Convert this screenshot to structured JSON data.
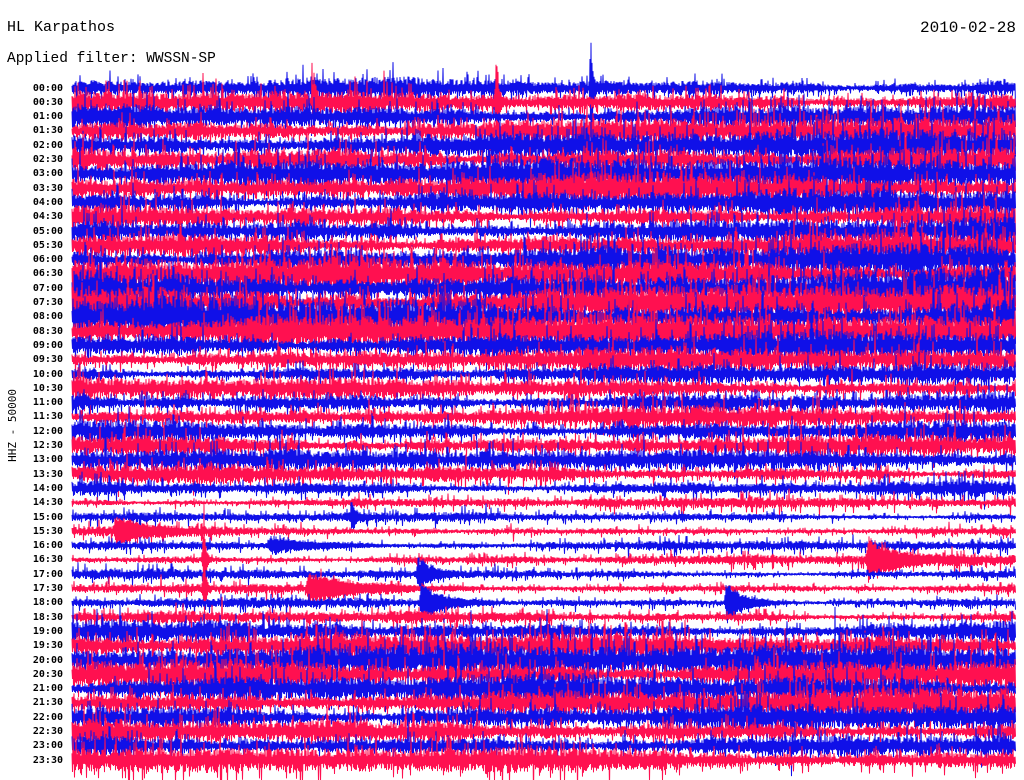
{
  "chart_data": {
    "type": "line",
    "title": "HL Karpathos",
    "date": "2010-02-28",
    "subtitle": "Applied filter: WWSSN-SP",
    "ylabel": "HHZ - 50000",
    "xlim": [
      0,
      30
    ],
    "categories": [
      "00:00",
      "00:30",
      "01:00",
      "01:30",
      "02:00",
      "02:30",
      "03:00",
      "03:30",
      "04:00",
      "04:30",
      "05:00",
      "05:30",
      "06:00",
      "06:30",
      "07:00",
      "07:30",
      "08:00",
      "08:30",
      "09:00",
      "09:30",
      "10:00",
      "10:30",
      "11:00",
      "11:30",
      "12:00",
      "12:30",
      "13:00",
      "13:30",
      "14:00",
      "14:30",
      "15:00",
      "15:30",
      "16:00",
      "16:30",
      "17:00",
      "17:30",
      "18:00",
      "18:30",
      "19:00",
      "19:30",
      "20:00",
      "20:30",
      "21:00",
      "21:30",
      "22:00",
      "22:30",
      "23:00",
      "23:30"
    ],
    "trace_colors": [
      "#1010e8",
      "#ff1050"
    ],
    "amplitude": [
      1.6,
      2.0,
      2.1,
      2.2,
      2.4,
      2.6,
      2.6,
      2.4,
      2.2,
      2.0,
      2.2,
      2.2,
      2.5,
      2.8,
      3.0,
      3.2,
      3.1,
      2.9,
      2.4,
      2.0,
      1.5,
      1.7,
      1.8,
      1.7,
      1.8,
      1.7,
      1.6,
      1.5,
      1.2,
      0.8,
      0.75,
      0.75,
      0.8,
      0.8,
      0.8,
      0.85,
      0.8,
      0.95,
      1.7,
      2.1,
      2.5,
      2.5,
      2.3,
      2.3,
      2.1,
      2.0,
      2.0,
      2.1
    ],
    "events": [
      {
        "row": "00:00",
        "minute": 16.5,
        "amplitude": 4.0,
        "duration": 0.05
      },
      {
        "row": "00:30",
        "minute": 13.5,
        "amplitude": 3.5,
        "duration": 0.05
      },
      {
        "row": "00:30",
        "minute": 7.7,
        "amplitude": 2.5,
        "duration": 0.05
      },
      {
        "row": "15:00",
        "minute": 8.9,
        "amplitude": 1.0,
        "duration": 0.1
      },
      {
        "row": "15:30",
        "minute": 1.4,
        "amplitude": 0.8,
        "duration": 1.0
      },
      {
        "row": "16:00",
        "minute": 6.3,
        "amplitude": 0.5,
        "duration": 1.5
      },
      {
        "row": "16:30",
        "minute": 4.2,
        "amplitude": 4.0,
        "duration": 0.05
      },
      {
        "row": "16:30",
        "minute": 25.3,
        "amplitude": 1.3,
        "duration": 1.0
      },
      {
        "row": "17:00",
        "minute": 11.0,
        "amplitude": 1.0,
        "duration": 0.5
      },
      {
        "row": "17:30",
        "minute": 7.5,
        "amplitude": 0.9,
        "duration": 1.5
      },
      {
        "row": "17:30",
        "minute": 4.2,
        "amplitude": 2.5,
        "duration": 0.05
      },
      {
        "row": "18:00",
        "minute": 11.1,
        "amplitude": 1.3,
        "duration": 0.6
      },
      {
        "row": "18:00",
        "minute": 20.8,
        "amplitude": 1.4,
        "duration": 0.5
      }
    ]
  }
}
